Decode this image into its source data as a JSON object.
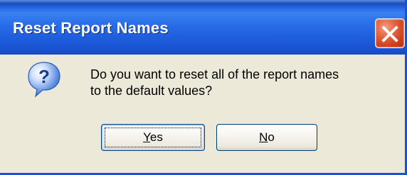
{
  "window": {
    "title": "Reset Report Names",
    "title_color": "#ffffff",
    "titlebar_color": "#2a6ee8",
    "body_color": "#ece9d8"
  },
  "icons": {
    "close": "close-icon",
    "question": "question-icon"
  },
  "message": {
    "line1": "Do you want to reset all of the report names",
    "line2": "to the default values?"
  },
  "buttons": {
    "yes": {
      "mnemonic": "Y",
      "rest": "es"
    },
    "no": {
      "mnemonic": "N",
      "rest": "o"
    }
  }
}
